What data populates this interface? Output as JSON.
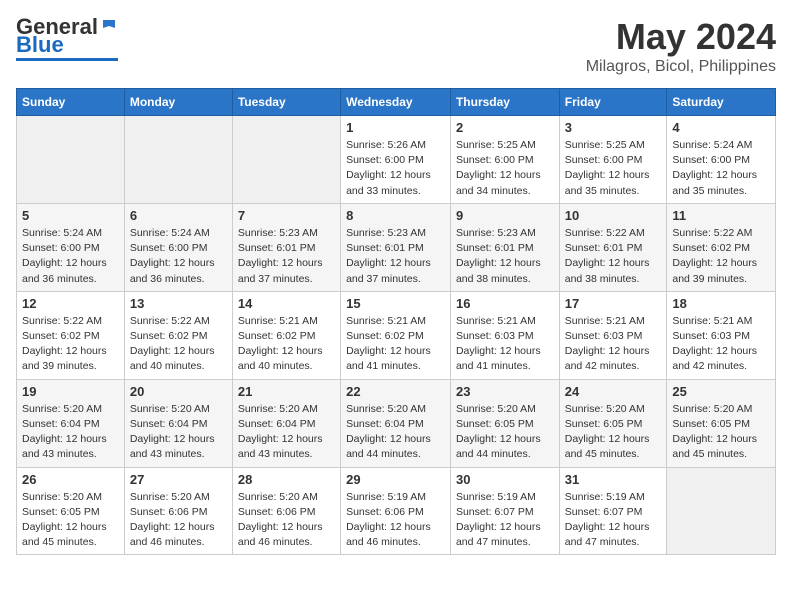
{
  "logo": {
    "general": "General",
    "blue": "Blue"
  },
  "title": {
    "month": "May 2024",
    "location": "Milagros, Bicol, Philippines"
  },
  "weekdays": [
    "Sunday",
    "Monday",
    "Tuesday",
    "Wednesday",
    "Thursday",
    "Friday",
    "Saturday"
  ],
  "weeks": [
    [
      {
        "day": "",
        "info": ""
      },
      {
        "day": "",
        "info": ""
      },
      {
        "day": "",
        "info": ""
      },
      {
        "day": "1",
        "info": "Sunrise: 5:26 AM\nSunset: 6:00 PM\nDaylight: 12 hours\nand 33 minutes."
      },
      {
        "day": "2",
        "info": "Sunrise: 5:25 AM\nSunset: 6:00 PM\nDaylight: 12 hours\nand 34 minutes."
      },
      {
        "day": "3",
        "info": "Sunrise: 5:25 AM\nSunset: 6:00 PM\nDaylight: 12 hours\nand 35 minutes."
      },
      {
        "day": "4",
        "info": "Sunrise: 5:24 AM\nSunset: 6:00 PM\nDaylight: 12 hours\nand 35 minutes."
      }
    ],
    [
      {
        "day": "5",
        "info": "Sunrise: 5:24 AM\nSunset: 6:00 PM\nDaylight: 12 hours\nand 36 minutes."
      },
      {
        "day": "6",
        "info": "Sunrise: 5:24 AM\nSunset: 6:00 PM\nDaylight: 12 hours\nand 36 minutes."
      },
      {
        "day": "7",
        "info": "Sunrise: 5:23 AM\nSunset: 6:01 PM\nDaylight: 12 hours\nand 37 minutes."
      },
      {
        "day": "8",
        "info": "Sunrise: 5:23 AM\nSunset: 6:01 PM\nDaylight: 12 hours\nand 37 minutes."
      },
      {
        "day": "9",
        "info": "Sunrise: 5:23 AM\nSunset: 6:01 PM\nDaylight: 12 hours\nand 38 minutes."
      },
      {
        "day": "10",
        "info": "Sunrise: 5:22 AM\nSunset: 6:01 PM\nDaylight: 12 hours\nand 38 minutes."
      },
      {
        "day": "11",
        "info": "Sunrise: 5:22 AM\nSunset: 6:02 PM\nDaylight: 12 hours\nand 39 minutes."
      }
    ],
    [
      {
        "day": "12",
        "info": "Sunrise: 5:22 AM\nSunset: 6:02 PM\nDaylight: 12 hours\nand 39 minutes."
      },
      {
        "day": "13",
        "info": "Sunrise: 5:22 AM\nSunset: 6:02 PM\nDaylight: 12 hours\nand 40 minutes."
      },
      {
        "day": "14",
        "info": "Sunrise: 5:21 AM\nSunset: 6:02 PM\nDaylight: 12 hours\nand 40 minutes."
      },
      {
        "day": "15",
        "info": "Sunrise: 5:21 AM\nSunset: 6:02 PM\nDaylight: 12 hours\nand 41 minutes."
      },
      {
        "day": "16",
        "info": "Sunrise: 5:21 AM\nSunset: 6:03 PM\nDaylight: 12 hours\nand 41 minutes."
      },
      {
        "day": "17",
        "info": "Sunrise: 5:21 AM\nSunset: 6:03 PM\nDaylight: 12 hours\nand 42 minutes."
      },
      {
        "day": "18",
        "info": "Sunrise: 5:21 AM\nSunset: 6:03 PM\nDaylight: 12 hours\nand 42 minutes."
      }
    ],
    [
      {
        "day": "19",
        "info": "Sunrise: 5:20 AM\nSunset: 6:04 PM\nDaylight: 12 hours\nand 43 minutes."
      },
      {
        "day": "20",
        "info": "Sunrise: 5:20 AM\nSunset: 6:04 PM\nDaylight: 12 hours\nand 43 minutes."
      },
      {
        "day": "21",
        "info": "Sunrise: 5:20 AM\nSunset: 6:04 PM\nDaylight: 12 hours\nand 43 minutes."
      },
      {
        "day": "22",
        "info": "Sunrise: 5:20 AM\nSunset: 6:04 PM\nDaylight: 12 hours\nand 44 minutes."
      },
      {
        "day": "23",
        "info": "Sunrise: 5:20 AM\nSunset: 6:05 PM\nDaylight: 12 hours\nand 44 minutes."
      },
      {
        "day": "24",
        "info": "Sunrise: 5:20 AM\nSunset: 6:05 PM\nDaylight: 12 hours\nand 45 minutes."
      },
      {
        "day": "25",
        "info": "Sunrise: 5:20 AM\nSunset: 6:05 PM\nDaylight: 12 hours\nand 45 minutes."
      }
    ],
    [
      {
        "day": "26",
        "info": "Sunrise: 5:20 AM\nSunset: 6:05 PM\nDaylight: 12 hours\nand 45 minutes."
      },
      {
        "day": "27",
        "info": "Sunrise: 5:20 AM\nSunset: 6:06 PM\nDaylight: 12 hours\nand 46 minutes."
      },
      {
        "day": "28",
        "info": "Sunrise: 5:20 AM\nSunset: 6:06 PM\nDaylight: 12 hours\nand 46 minutes."
      },
      {
        "day": "29",
        "info": "Sunrise: 5:19 AM\nSunset: 6:06 PM\nDaylight: 12 hours\nand 46 minutes."
      },
      {
        "day": "30",
        "info": "Sunrise: 5:19 AM\nSunset: 6:07 PM\nDaylight: 12 hours\nand 47 minutes."
      },
      {
        "day": "31",
        "info": "Sunrise: 5:19 AM\nSunset: 6:07 PM\nDaylight: 12 hours\nand 47 minutes."
      },
      {
        "day": "",
        "info": ""
      }
    ]
  ]
}
